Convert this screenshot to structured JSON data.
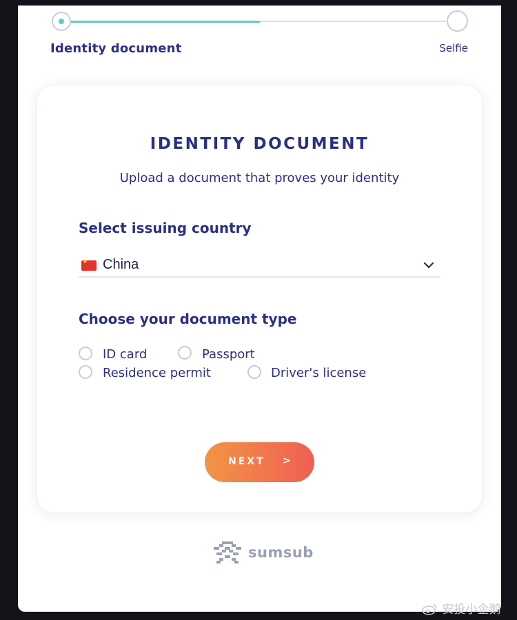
{
  "stepper": {
    "steps": [
      {
        "label": "Identity document",
        "state": "active"
      },
      {
        "label": "Selfie",
        "state": "pending"
      }
    ],
    "progress": 0.5
  },
  "card": {
    "title": "IDENTITY DOCUMENT",
    "subtitle": "Upload a document that proves your identity",
    "country": {
      "label": "Select issuing country",
      "selected": "China",
      "flag_icon": "china-flag-icon"
    },
    "doc_type": {
      "label": "Choose your document type",
      "options": [
        "ID card",
        "Passport",
        "Residence permit",
        "Driver's license"
      ]
    },
    "next_button": {
      "label": "NEXT",
      "arrow": ">"
    }
  },
  "brand": {
    "name": "sumsub",
    "logo_icon": "sumsub-logo-icon"
  },
  "watermark": {
    "text": "安投小企鹅",
    "icon": "weibo-icon"
  },
  "colors": {
    "primary_text": "#2b2f86",
    "accent_teal": "#5ecbc6",
    "button_gradient_start": "#f39445",
    "button_gradient_end": "#ef5f53",
    "background_dark": "#121419"
  }
}
